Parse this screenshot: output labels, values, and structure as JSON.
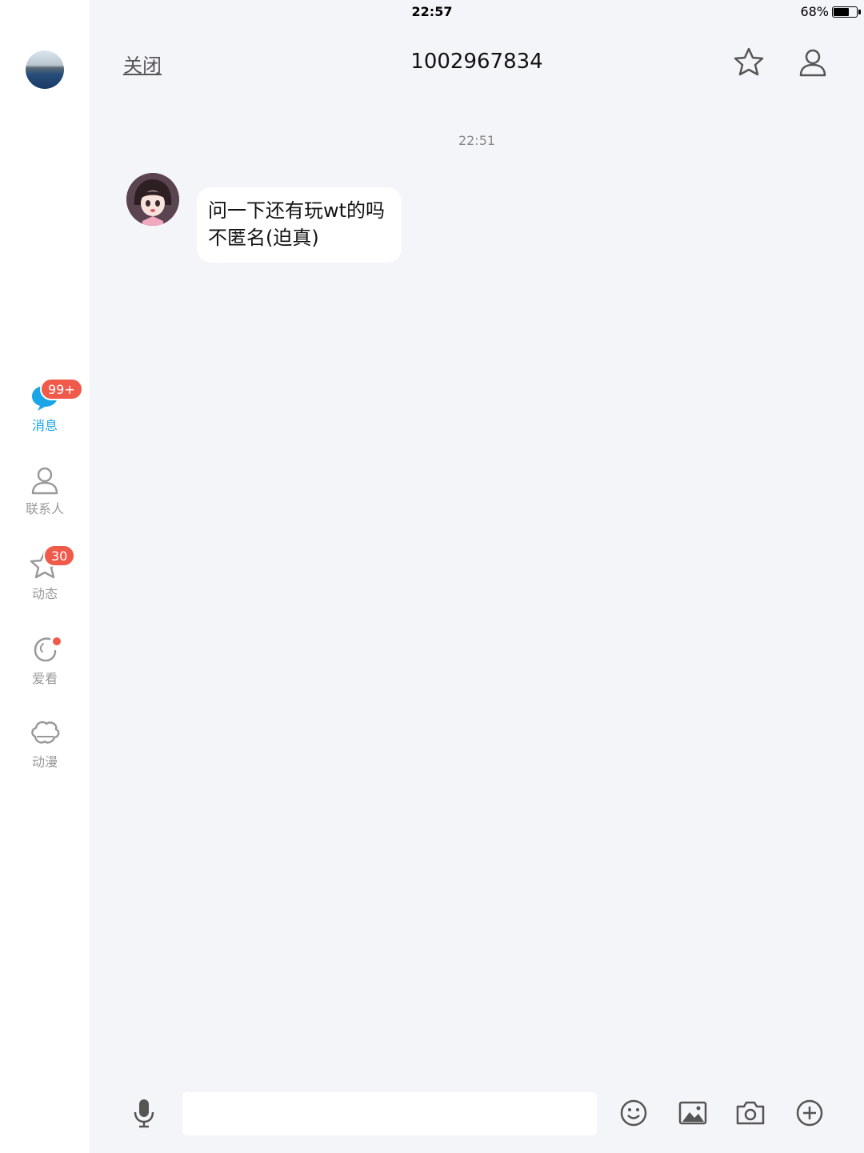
{
  "statusbar": {
    "device": "iPad",
    "time": "22:57",
    "battery": "68%",
    "battery_fraction": 0.68
  },
  "sidebar": {
    "items": [
      {
        "label": "消息",
        "badge": "99+",
        "active": true
      },
      {
        "label": "联系人"
      },
      {
        "label": "动态",
        "badge": "30"
      },
      {
        "label": "爱看",
        "dot": true
      },
      {
        "label": "动漫"
      }
    ]
  },
  "header": {
    "close_label": "关闭",
    "title": "1002967834"
  },
  "chat": {
    "timestamp": "22:51",
    "messages": [
      {
        "lines": [
          "问一下还有玩wt的吗",
          "不匿名(迫真)"
        ]
      }
    ]
  },
  "input": {
    "value": "",
    "placeholder": ""
  },
  "colors": {
    "accent": "#1aa6e6",
    "badge": "#f05a4a",
    "background": "#f4f5f9"
  }
}
